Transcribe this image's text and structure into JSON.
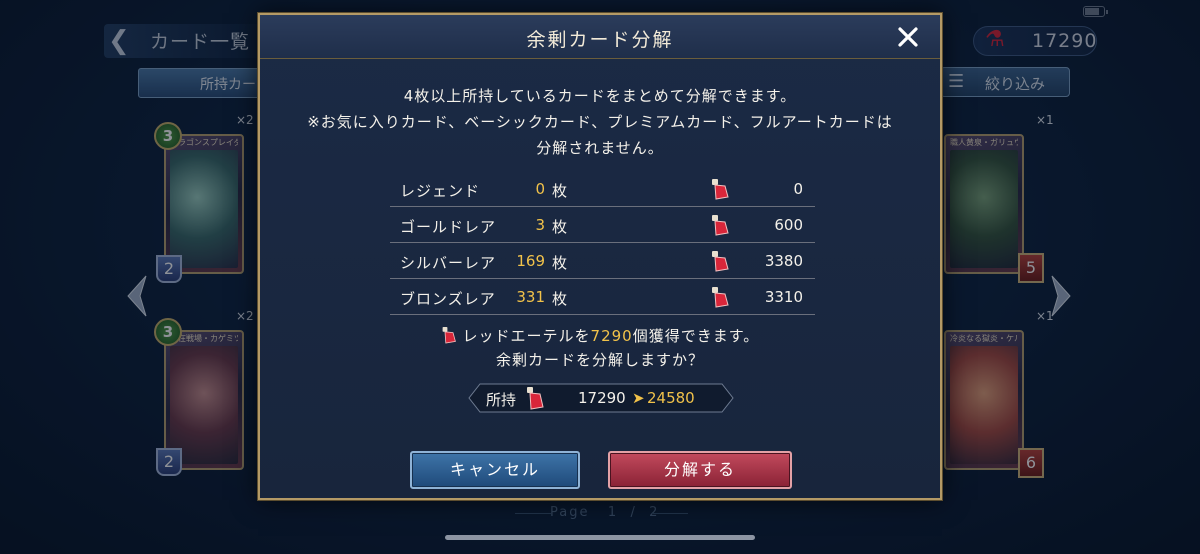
{
  "screen": {
    "back_title": "カード一覧",
    "currency_value": "17290",
    "tab_owned": "所持カード",
    "filter_label": "絞り込み",
    "page_label": "Page",
    "page_current": "1",
    "page_sep": "/",
    "page_total": "2"
  },
  "cards": [
    {
      "name": "ドラゴンスプレイダー・ナナ",
      "cost": "3",
      "count": "×2",
      "life": "2"
    },
    {
      "name": "常在戦場・カゲミツ",
      "cost": "3",
      "count": "×2",
      "life": "2"
    },
    {
      "name": "職人黄泉・ガリュウ",
      "cost": "",
      "count": "×1",
      "power": "5"
    },
    {
      "name": "冷炎なる獄炎・ケルベロス",
      "cost": "",
      "count": "×1",
      "power": "6"
    }
  ],
  "dialog": {
    "title": "余剰カード分解",
    "desc_line1": "4枚以上所持しているカードをまとめて分解できます。",
    "desc_line2": "※お気に入りカード、ベーシックカード、プレミアムカード、フルアートカードは",
    "desc_line3": "分解されません。",
    "unit": "枚",
    "rows": [
      {
        "name": "レジェンド",
        "count": "0",
        "value": "0"
      },
      {
        "name": "ゴールドレア",
        "count": "3",
        "value": "600"
      },
      {
        "name": "シルバーレア",
        "count": "169",
        "value": "3380"
      },
      {
        "name": "ブロンズレア",
        "count": "331",
        "value": "3310"
      }
    ],
    "result_prefix": "レッドエーテルを",
    "result_amount": "7290",
    "result_suffix": "個獲得できます。",
    "confirm_question": "余剰カードを分解しますか？",
    "owned_label": "所持",
    "owned_before": "17290",
    "owned_arrow": "➤",
    "owned_after": "24580",
    "cancel_label": "キャンセル",
    "confirm_label": "分解する"
  },
  "colors": {
    "accent_gold": "#f1c24a",
    "ether_red": "#d9263a",
    "cancel_blue": "#2d5f93",
    "confirm_red": "#a8344a"
  }
}
